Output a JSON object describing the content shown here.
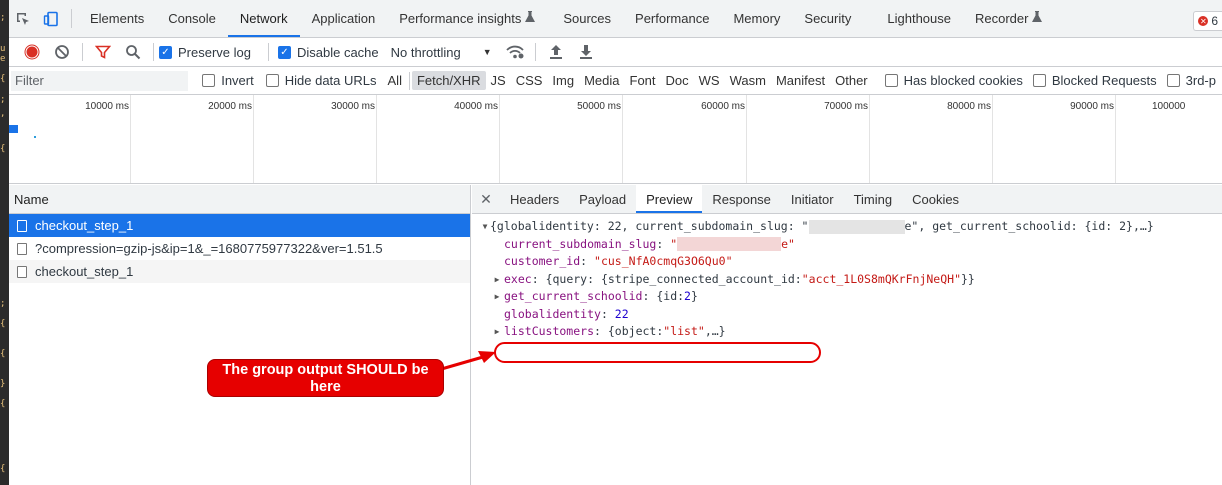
{
  "devtools_tabs": [
    "Elements",
    "Console",
    "Network",
    "Application",
    "Performance insights",
    "Sources",
    "Performance",
    "Memory",
    "Security",
    "Lighthouse",
    "Recorder"
  ],
  "error_count": "6",
  "toolbar": {
    "preserve_log": "Preserve log",
    "disable_cache": "Disable cache",
    "throttling": "No throttling"
  },
  "filterbar": {
    "placeholder": "Filter",
    "invert": "Invert",
    "hide_data_urls": "Hide data URLs",
    "types": [
      "All",
      "Fetch/XHR",
      "JS",
      "CSS",
      "Img",
      "Media",
      "Font",
      "Doc",
      "WS",
      "Wasm",
      "Manifest",
      "Other"
    ],
    "selected_type": "Fetch/XHR",
    "blocked_cookies": "Has blocked cookies",
    "blocked_requests": "Blocked Requests",
    "third_party": "3rd-p"
  },
  "overview": {
    "ticks": [
      "10000 ms",
      "20000 ms",
      "30000 ms",
      "40000 ms",
      "50000 ms",
      "60000 ms",
      "70000 ms",
      "80000 ms",
      "90000 ms",
      "100000"
    ]
  },
  "requests": {
    "header": "Name",
    "rows": [
      "checkout_step_1",
      "?compression=gzip-js&ip=1&_=1680775977322&ver=1.51.5",
      "checkout_step_1"
    ],
    "selected_index": 0
  },
  "detail_tabs": [
    "Headers",
    "Payload",
    "Preview",
    "Response",
    "Initiator",
    "Timing",
    "Cookies"
  ],
  "preview": {
    "line0_a": "{globalidentity: 22, current_subdomain_slug: \"",
    "line0_b": "e\", get_current_schoolid: {id: 2},…}",
    "slug_key": "current_subdomain_slug",
    "slug_open": "\"",
    "slug_close": "e\"",
    "customer_key": "customer_id",
    "customer_val": "\"cus_NfA0cmqG3O6Qu0\"",
    "exec_key": "exec",
    "exec_a": "{query: {stripe_connected_account_id: ",
    "exec_val": "\"acct_1L0S8mQKrFnjNeQH\"",
    "exec_b": "}}",
    "school_key": "get_current_schoolid",
    "school_a": "{id: ",
    "school_val": "2",
    "school_b": "}",
    "gi_key": "globalidentity",
    "gi_val": "22",
    "lc_key": "listCustomers",
    "lc_a": "{object: ",
    "lc_val": "\"list\"",
    "lc_b": ",…}"
  },
  "annotation": {
    "text": "The group output SHOULD be here",
    "color": "#e60000"
  }
}
